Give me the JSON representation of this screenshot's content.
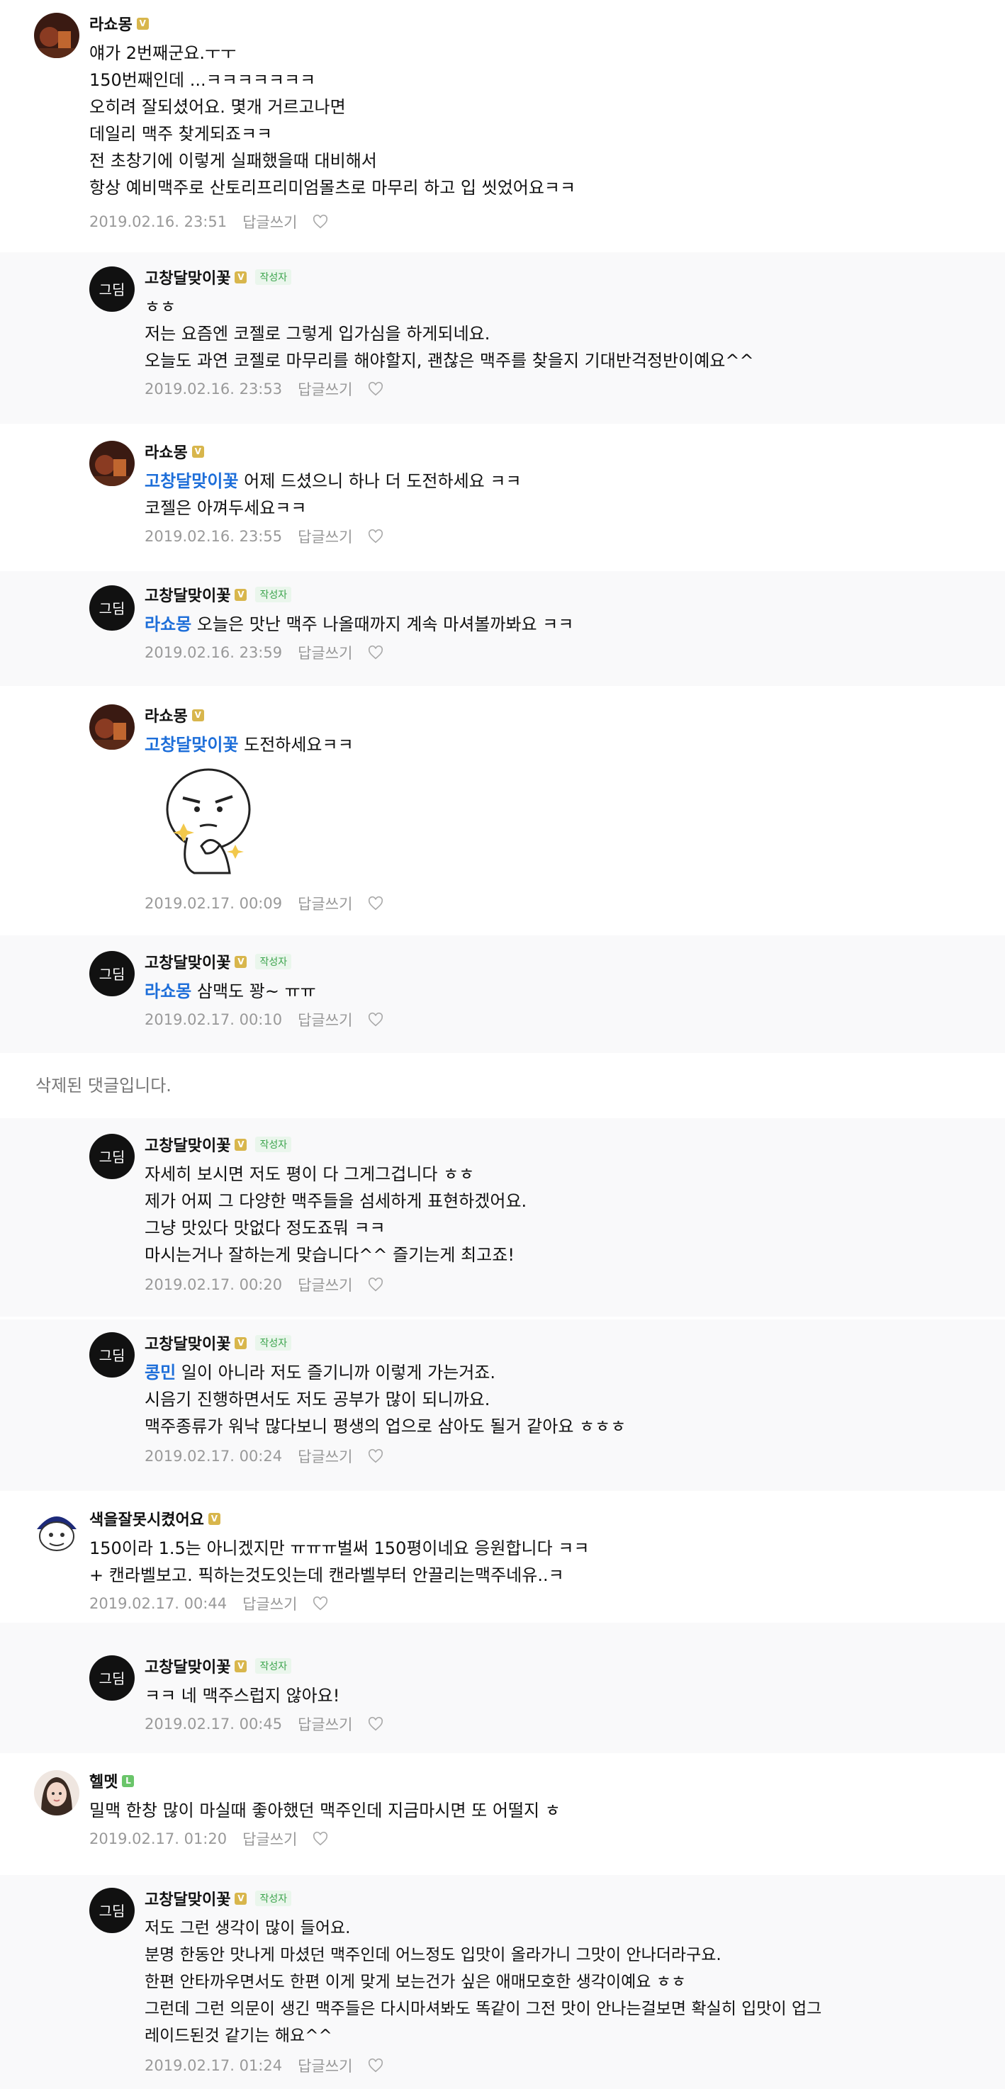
{
  "reply_label": "답글쓰기",
  "author_badge": "작성자",
  "deleted_text": "삭제된 댓글입니다.",
  "comments": [
    {
      "nick": "라쇼몽",
      "lines": [
        "얘가 2번째군요.ㅜㅜ",
        "150번째인데 ...ㅋㅋㅋㅋㅋㅋㅋ",
        "오히려 잘되셨어요. 몇개 거르고나면",
        "데일리 맥주 찾게되죠ㅋㅋ",
        "전 초창기에 이렇게 실패했을때 대비해서",
        "항상 예비맥주로 산토리프리미엄몰츠로 마무리 하고 입 씻었어요ㅋㅋ"
      ],
      "date": "2019.02.16. 23:51"
    },
    {
      "nick": "고창달맞이꽃",
      "lines": [
        "ㅎㅎ",
        "저는 요즘엔 코젤로 그렇게 입가심을 하게되네요.",
        "오늘도 과연 코젤로 마무리를 해야할지, 괜찮은 맥주를 찾을지 기대반걱정반이예요^^"
      ],
      "date": "2019.02.16. 23:53"
    },
    {
      "nick": "라쇼몽",
      "mention": "고창달맞이꽃",
      "first_line": " 어제 드셨으니 하나 더 도전하세요 ㅋㅋ",
      "lines": [
        "코젤은 아껴두세요ㅋㅋ"
      ],
      "date": "2019.02.16. 23:55"
    },
    {
      "nick": "고창달맞이꽃",
      "mention": "라쇼몽",
      "first_line": " 오늘은 맛난 맥주 나올때까지 계속 마셔볼까봐요 ㅋㅋ",
      "date": "2019.02.16. 23:59"
    },
    {
      "nick": "라쇼몽",
      "mention": "고창달맞이꽃",
      "first_line": " 도전하세요ㅋㅋ",
      "date": "2019.02.17. 00:09"
    },
    {
      "nick": "고창달맞이꽃",
      "mention": "라쇼몽",
      "first_line": " 삼맥도 꽝~ ㅠㅠ",
      "date": "2019.02.17. 00:10"
    },
    {
      "nick": "고창달맞이꽃",
      "lines": [
        "자세히 보시면 저도 평이 다 그게그겁니다 ㅎㅎ",
        "제가 어찌 그 다양한 맥주들을 섬세하게 표현하겠어요.",
        "그냥 맛있다 맛없다 정도죠뭐 ㅋㅋ",
        "마시는거나 잘하는게 맞습니다^^ 즐기는게 최고죠!"
      ],
      "date": "2019.02.17. 00:20"
    },
    {
      "nick": "고창달맞이꽃",
      "mention": "콩민",
      "first_line": " 일이 아니라 저도 즐기니까 이렇게 가는거죠.",
      "lines": [
        "시음기 진행하면서도 저도 공부가 많이 되니까요.",
        "맥주종류가 워낙 많다보니 평생의 업으로 삼아도 될거 같아요 ㅎㅎㅎ"
      ],
      "date": "2019.02.17. 00:24"
    },
    {
      "nick": "색을잘못시켰어요",
      "lines": [
        "150이라 1.5는 아니겠지만 ㅠㅠㅠ벌써 150평이네요 응원합니다 ㅋㅋ",
        "+ 캔라벨보고. 픽하는것도잇는데 캔라벨부터 안끌리는맥주네유..ㅋ"
      ],
      "date": "2019.02.17. 00:44"
    },
    {
      "nick": "고창달맞이꽃",
      "lines": [
        "ㅋㅋ 네 맥주스럽지 않아요!"
      ],
      "date": "2019.02.17. 00:45"
    },
    {
      "nick": "헬멧",
      "lines": [
        "밀맥 한창 많이 마실때 좋아했던 맥주인데 지금마시면 또 어떨지 ㅎ"
      ],
      "date": "2019.02.17. 01:20"
    },
    {
      "nick": "고창달맞이꽃",
      "lines": [
        "저도 그런 생각이 많이 들어요.",
        "분명 한동안 맛나게 마셨던 맥주인데 어느정도 입맛이 올라가니 그맛이 안나더라구요.",
        "한편 안타까우면서도 한편 이게 맞게 보는건가 싶은 애매모호한 생각이예요 ㅎㅎ",
        "그런데 그런 의문이 생긴 맥주들은 다시마셔봐도 똑같이 그전 맛이 안나는걸보면 확실히 입맛이 업그",
        "레이드된것 같기는 해요^^"
      ],
      "date": "2019.02.17. 01:24"
    }
  ]
}
